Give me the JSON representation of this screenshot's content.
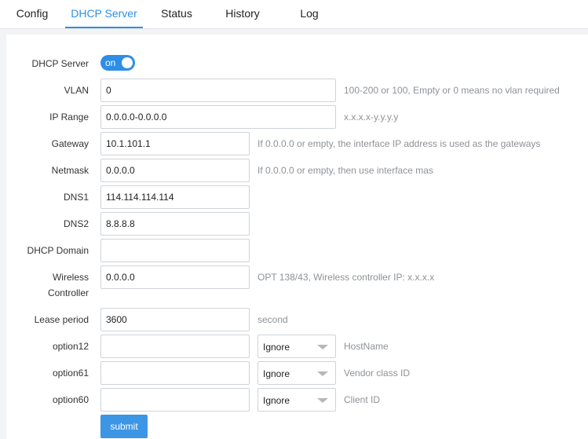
{
  "tabs": [
    "Config",
    "DHCP Server",
    "Status",
    "History",
    "Log"
  ],
  "form": {
    "dhcp_server": {
      "label": "DHCP Server",
      "toggle_text": "on"
    },
    "vlan": {
      "label": "VLAN",
      "value": "0",
      "hint": "100-200 or 100, Empty or 0 means no vlan required"
    },
    "ip_range": {
      "label": "IP Range",
      "value": "0.0.0.0-0.0.0.0",
      "hint": "x.x.x.x-y.y.y.y"
    },
    "gateway": {
      "label": "Gateway",
      "value": "10.1.101.1",
      "hint": "If 0.0.0.0 or empty, the interface IP address is used as the gateways"
    },
    "netmask": {
      "label": "Netmask",
      "value": "0.0.0.0",
      "hint": "If 0.0.0.0 or empty, then use interface mas"
    },
    "dns1": {
      "label": "DNS1",
      "value": "114.114.114.114"
    },
    "dns2": {
      "label": "DNS2",
      "value": "8.8.8.8"
    },
    "dhcp_domain": {
      "label": "DHCP Domain",
      "value": ""
    },
    "wireless_controller": {
      "label_line1": "Wireless",
      "label_line2": "Controller",
      "value": "0.0.0.0",
      "hint": "OPT 138/43, Wireless controller IP: x.x.x.x"
    },
    "lease_period": {
      "label": "Lease period",
      "value": "3600",
      "hint": "second"
    },
    "option12": {
      "label": "option12",
      "value": "",
      "select": "Ignore",
      "hint": "HostName"
    },
    "option61": {
      "label": "option61",
      "value": "",
      "select": "Ignore",
      "hint": "Vendor class ID"
    },
    "option60": {
      "label": "option60",
      "value": "",
      "select": "Ignore",
      "hint": "Client ID"
    },
    "submit_label": "submit"
  }
}
